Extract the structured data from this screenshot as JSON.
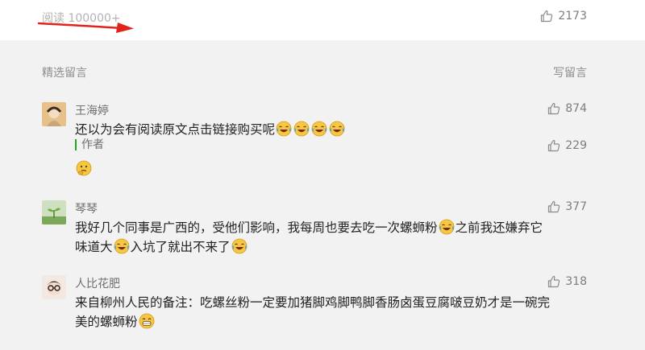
{
  "header": {
    "read_label": "阅读 100000+",
    "like_count": "2173"
  },
  "comments_section": {
    "title": "精选留言",
    "write_label": "写留言"
  },
  "comments": [
    {
      "name": "王海婷",
      "likes": "874",
      "text_parts": [
        "还以为会有阅读原文点击链接购买呢"
      ],
      "reply": {
        "label": "作者",
        "likes": "229"
      }
    },
    {
      "name": "琴琴",
      "likes": "377",
      "text_parts": [
        "我好几个同事是广西的，受他们影响，我每周也要去吃一次螺蛳粉",
        "之前我还嫌弃它味道大",
        "入坑了就出不来了"
      ]
    },
    {
      "name": "人比花肥",
      "likes": "318",
      "text_parts": [
        "来自柳州人民的备注：吃螺丝粉一定要加猪脚鸡脚鸭脚香肠卤蛋豆腐啵豆奶才是一碗完美的螺蛳粉"
      ]
    }
  ],
  "colors": {
    "accent_green": "#1aad19",
    "arrow_red": "#e0231b",
    "emoji_yellow": "#f6c743"
  }
}
